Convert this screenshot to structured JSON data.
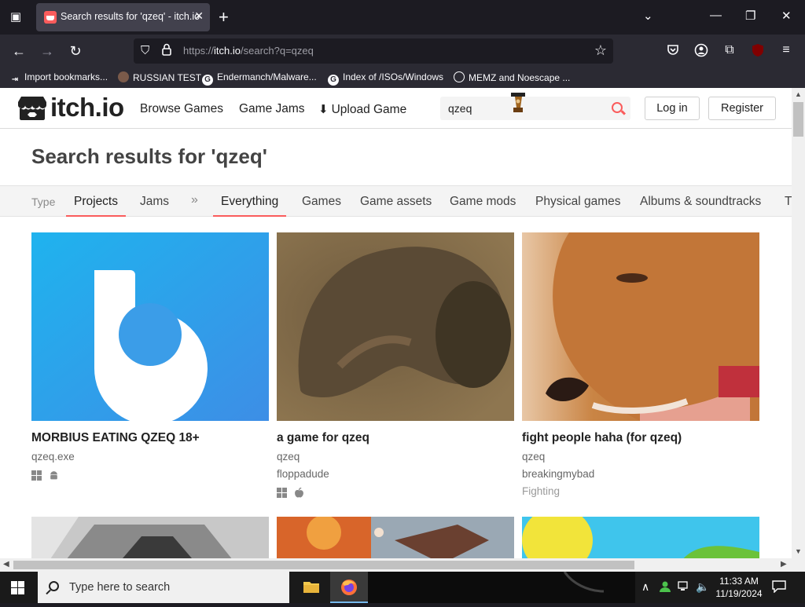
{
  "browser": {
    "tab_title": "Search results for 'qzeq' - itch.io",
    "url_prefix": "https://",
    "url_domain": "itch.io",
    "url_path": "/search?q=qzeq",
    "extension_badge": "2",
    "bookmarks": [
      {
        "label": "Import bookmarks...",
        "icon": "import-icon"
      },
      {
        "label": "RUSSIAN TEST",
        "icon": "site-icon"
      },
      {
        "label": "Endermanch/Malware...",
        "icon": "google-icon"
      },
      {
        "label": "Index of /ISOs/Windows",
        "icon": "google-icon"
      },
      {
        "label": "MEMZ and Noescape ...",
        "icon": "globe-icon"
      }
    ]
  },
  "header": {
    "logo": "itch.io",
    "nav": [
      "Browse Games",
      "Game Jams",
      "Upload Game"
    ],
    "search_value": "qzeq",
    "login": "Log in",
    "register": "Register"
  },
  "page_title": "Search results for 'qzeq'",
  "filters": {
    "type_label": "Type",
    "types": [
      "Projects",
      "Jams"
    ],
    "sep": "»",
    "categories": [
      "Everything",
      "Games",
      "Game assets",
      "Game mods",
      "Physical games",
      "Albums & soundtracks",
      "T"
    ]
  },
  "results": [
    {
      "title": "MORBIUS EATING QZEQ 18+",
      "lines": [
        "qzeq.exe"
      ],
      "platforms": [
        "windows-icon",
        "android-icon"
      ]
    },
    {
      "title": "a game for qzeq",
      "lines": [
        "qzeq",
        "floppadude"
      ],
      "platforms": [
        "windows-icon",
        "apple-icon"
      ]
    },
    {
      "title": "fight people haha (for qzeq)",
      "lines": [
        "qzeq",
        "breakingmybad"
      ],
      "genre": "Fighting",
      "platforms": []
    }
  ],
  "taskbar": {
    "search_placeholder": "Type here to search",
    "time": "11:33 AM",
    "date": "11/19/2024"
  },
  "colors": {
    "accent": "#fa5c5c",
    "thumb1": "#2d9ae6"
  }
}
